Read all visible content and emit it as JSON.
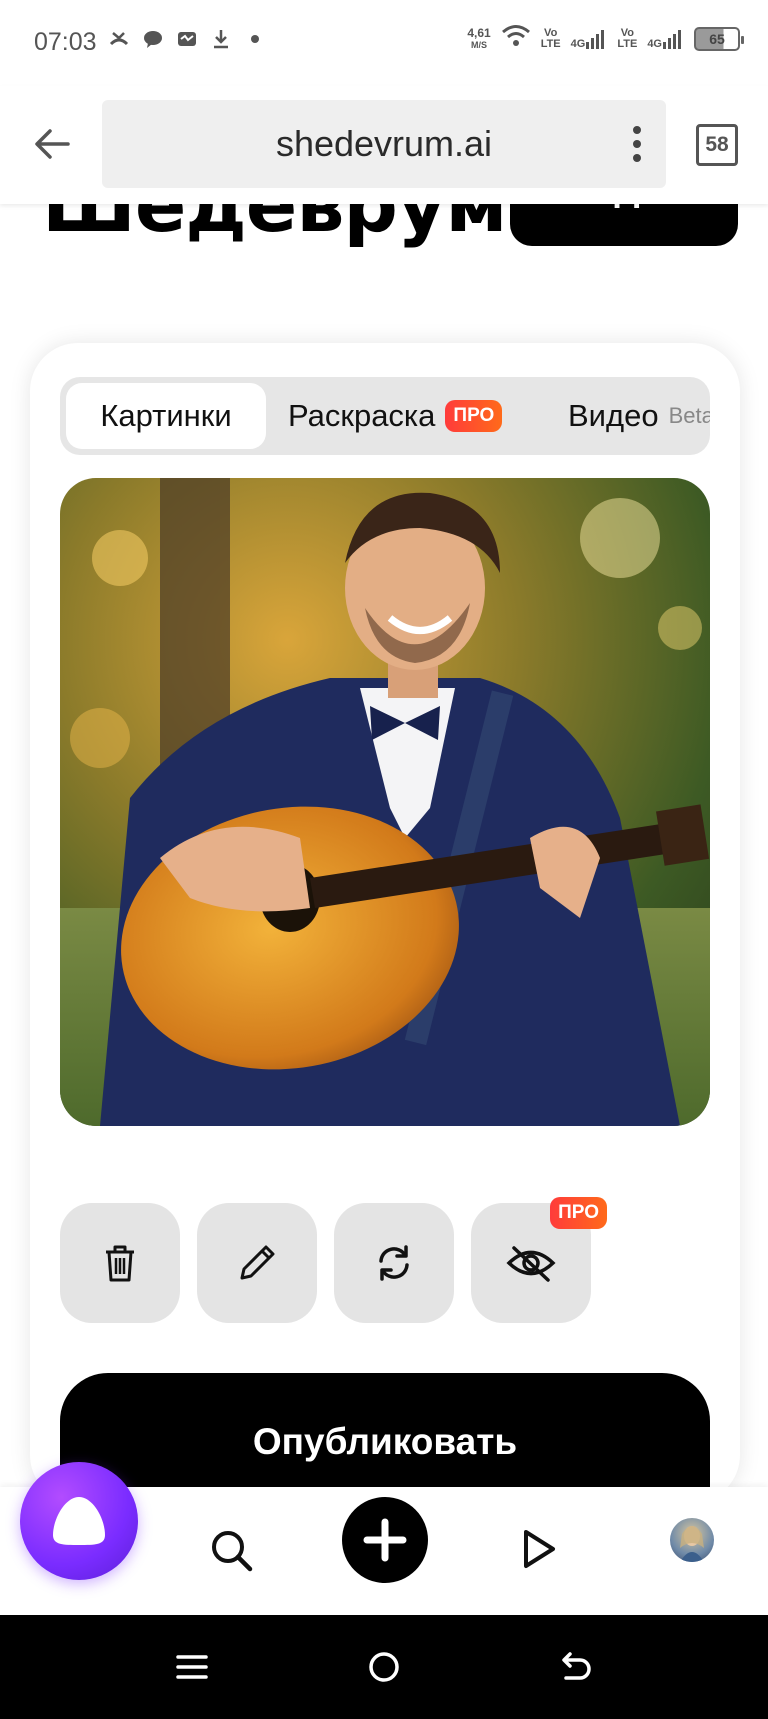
{
  "status_bar": {
    "time": "07:03",
    "net_speed_value": "4,61",
    "net_speed_unit": "M/S",
    "sim1_tech": "Vo\nLTE",
    "sim1_gen": "4G",
    "sim2_tech": "Vo\nLTE",
    "sim2_gen": "4G",
    "battery": "65",
    "icons": [
      "missed-call-icon",
      "chat-icon",
      "message-icon",
      "download-icon",
      "dot-icon",
      "wifi-icon",
      "signal-icon",
      "battery-icon"
    ]
  },
  "browser": {
    "url": "shedevrum.ai",
    "tab_count": "58"
  },
  "header": {
    "logo": "Шедеврум",
    "create_button": "Создать"
  },
  "tabs": [
    {
      "label": "Картинки",
      "active": true
    },
    {
      "label": "Раскраска",
      "badge": "ПРО"
    },
    {
      "label": "Видео",
      "suffix": "Beta"
    }
  ],
  "actions": {
    "hide_badge": "ПРО",
    "buttons": [
      "trash-icon",
      "pencil-icon",
      "refresh-icon",
      "eye-off-icon"
    ]
  },
  "publish_button": "Опубликовать",
  "colors": {
    "accent_pro": "#ff4a2a",
    "alice": "#7a2cff",
    "primary": "#000000"
  }
}
